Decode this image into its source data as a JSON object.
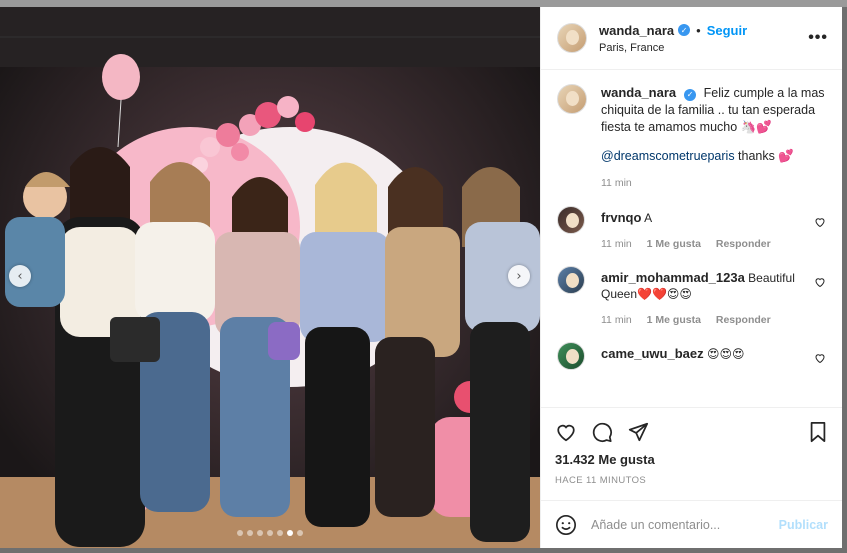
{
  "post": {
    "author": {
      "username": "wanda_nara",
      "verified": true,
      "location": "Paris, France",
      "follow_label": "Seguir",
      "separator": "•"
    },
    "caption": {
      "username": "wanda_nara",
      "text": "Feliz cumple a la mas chiquita de la familia .. tu tan esperada fiesta te amamos mucho 🦄💕",
      "mention": "@dreamscometrueparis",
      "mention_suffix": " thanks 💕",
      "time": "11 min"
    },
    "comments": [
      {
        "username": "frvnqo",
        "text": "A",
        "time": "11 min",
        "likes": "1 Me gusta",
        "reply": "Responder"
      },
      {
        "username": "amir_mohammad_123a",
        "text": "Beautiful Queen❤️❤️😍😍",
        "time": "11 min",
        "likes": "1 Me gusta",
        "reply": "Responder"
      },
      {
        "username": "came_uwu_baez",
        "text": "😍😍😍",
        "time": "",
        "likes": "",
        "reply": ""
      }
    ],
    "likes_count": "31.432 Me gusta",
    "posted_ago": "HACE 11 MINUTOS",
    "add_comment_placeholder": "Añade un comentario...",
    "publish_label": "Publicar",
    "carousel": {
      "slide_count": 7,
      "active_index": 5,
      "prev_icon": "‹",
      "next_icon": "›"
    }
  },
  "icons": {
    "more": "•••",
    "verified": "✓"
  },
  "colors": {
    "accent": "#0095f6",
    "verified": "#3897f0",
    "muted": "#8e8e8e"
  }
}
